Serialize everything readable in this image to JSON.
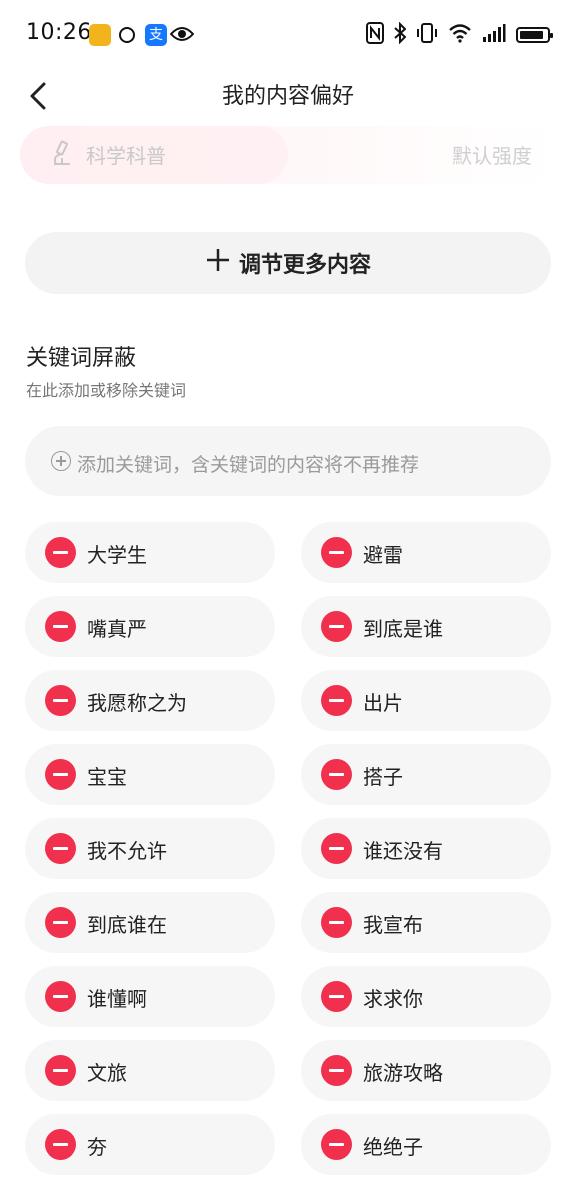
{
  "status_bar": {
    "time": "10:26",
    "app_badge_3": "支"
  },
  "header": {
    "title": "我的内容偏好"
  },
  "preference_row": {
    "label": "科学科普",
    "level": "默认强度"
  },
  "adjust_button": {
    "label": "调节更多内容"
  },
  "keyword_section": {
    "title": "关键词屏蔽",
    "subtitle": "在此添加或移除关键词",
    "add_placeholder": "添加关键词，含关键词的内容将不再推荐"
  },
  "keywords": [
    "大学生",
    "避雷",
    "嘴真严",
    "到底是谁",
    "我愿称之为",
    "出片",
    "宝宝",
    "搭子",
    "我不允许",
    "谁还没有",
    "到底谁在",
    "我宣布",
    "谁懂啊",
    "求求你",
    "文旅",
    "旅游攻略",
    "夯",
    "绝绝子"
  ],
  "colors": {
    "accent_red": "#f0304d",
    "chip_bg": "#f6f6f6",
    "button_bg": "#f3f3f3"
  }
}
